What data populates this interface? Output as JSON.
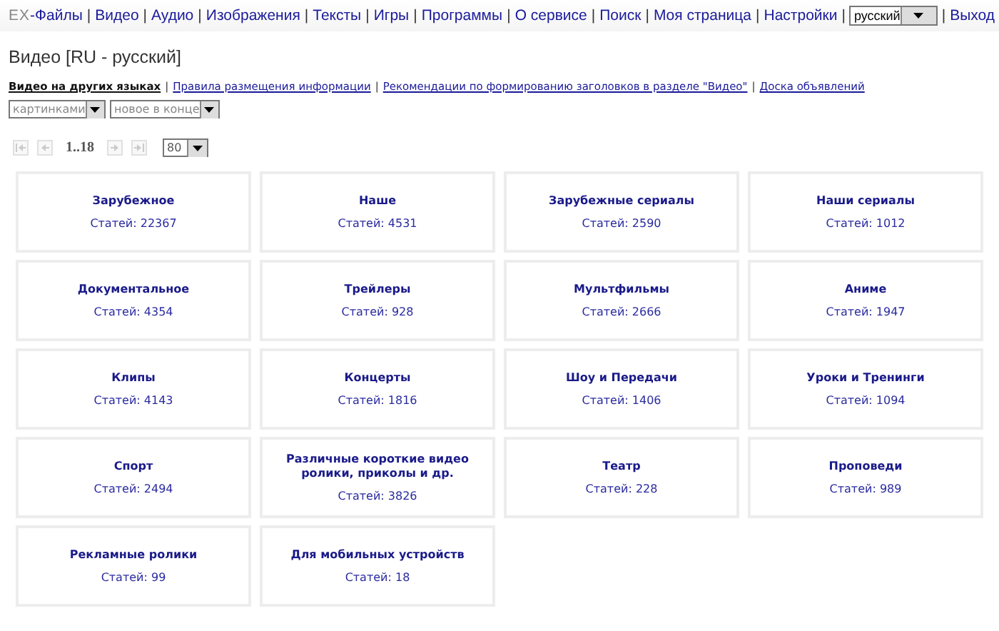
{
  "top_bar": {
    "logo": "EX",
    "nav": [
      {
        "kind": "link",
        "label": "-Файлы"
      },
      {
        "kind": "separator",
        "label": "|"
      },
      {
        "kind": "link",
        "label": "Видео"
      },
      {
        "kind": "separator",
        "label": "|"
      },
      {
        "kind": "link",
        "label": "Аудио"
      },
      {
        "kind": "separator",
        "label": "|"
      },
      {
        "kind": "link",
        "label": "Изображения"
      },
      {
        "kind": "separator",
        "label": "|"
      },
      {
        "kind": "link",
        "label": "Тексты"
      },
      {
        "kind": "separator",
        "label": "|"
      },
      {
        "kind": "link",
        "label": "Игры"
      },
      {
        "kind": "separator",
        "label": "|"
      },
      {
        "kind": "link",
        "label": "Программы"
      },
      {
        "kind": "separator",
        "label": "|"
      },
      {
        "kind": "link",
        "label": "О сервисе"
      },
      {
        "kind": "separator",
        "label": "|"
      },
      {
        "kind": "link",
        "label": "Поиск"
      }
    ],
    "right_nav": [
      {
        "kind": "separator",
        "label": "|"
      },
      {
        "kind": "link",
        "label": "Моя страница"
      },
      {
        "kind": "separator",
        "label": "|"
      },
      {
        "kind": "link",
        "label": "Настройки"
      },
      {
        "kind": "separator",
        "label": "|"
      },
      {
        "kind": "select",
        "label": "русский"
      },
      {
        "kind": "separator",
        "label": "|"
      },
      {
        "kind": "link",
        "label": "Выход"
      }
    ]
  },
  "heading": "Видео [RU - русский]",
  "links": [
    {
      "kind": "link",
      "label": "Видео на других языках",
      "selected": true
    },
    {
      "kind": "separator",
      "label": "|"
    },
    {
      "kind": "link",
      "label": "Правила размещения информации",
      "selected": false
    },
    {
      "kind": "separator",
      "label": "|"
    },
    {
      "kind": "link",
      "label": "Рекомендации по формированию заголовков в разделе \"Видео\"",
      "selected": false
    },
    {
      "kind": "separator",
      "label": "|"
    },
    {
      "kind": "link",
      "label": "Доска объявлений",
      "selected": false
    }
  ],
  "view_selects": [
    "картинками",
    "новое в конце"
  ],
  "pager": {
    "buttons": [
      {
        "kind": "first",
        "disabled": true
      },
      {
        "kind": "prev",
        "disabled": true
      },
      {
        "kind": "range",
        "label": "1..18"
      },
      {
        "kind": "next",
        "disabled": true
      },
      {
        "kind": "last",
        "disabled": true
      }
    ],
    "per_page": "80"
  },
  "categories": [
    {
      "title": "Зарубежное",
      "count": "Статей: 22367"
    },
    {
      "title": "Наше",
      "count": "Статей: 4531"
    },
    {
      "title": "Зарубежные сериалы",
      "count": "Статей: 2590"
    },
    {
      "title": "Наши сериалы",
      "count": "Статей: 1012"
    },
    {
      "title": "Документальное",
      "count": "Статей: 4354"
    },
    {
      "title": "Трейлеры",
      "count": "Статей: 928"
    },
    {
      "title": "Мультфильмы",
      "count": "Статей: 2666"
    },
    {
      "title": "Аниме",
      "count": "Статей: 1947"
    },
    {
      "title": "Клипы",
      "count": "Статей: 4143"
    },
    {
      "title": "Концерты",
      "count": "Статей: 1816"
    },
    {
      "title": "Шоу и Передачи",
      "count": "Статей: 1406"
    },
    {
      "title": "Уроки и Тренинги",
      "count": "Статей: 1094"
    },
    {
      "title": "Спорт",
      "count": "Статей: 2494"
    },
    {
      "title": "Различные короткие видео ролики, приколы и др.",
      "count": "Статей: 3826"
    },
    {
      "title": "Театр",
      "count": "Статей: 228"
    },
    {
      "title": "Проповеди",
      "count": "Статей: 989"
    },
    {
      "title": "Рекламные ролики",
      "count": "Статей: 99"
    },
    {
      "title": "Для мобильных устройств",
      "count": "Статей: 18"
    }
  ]
}
